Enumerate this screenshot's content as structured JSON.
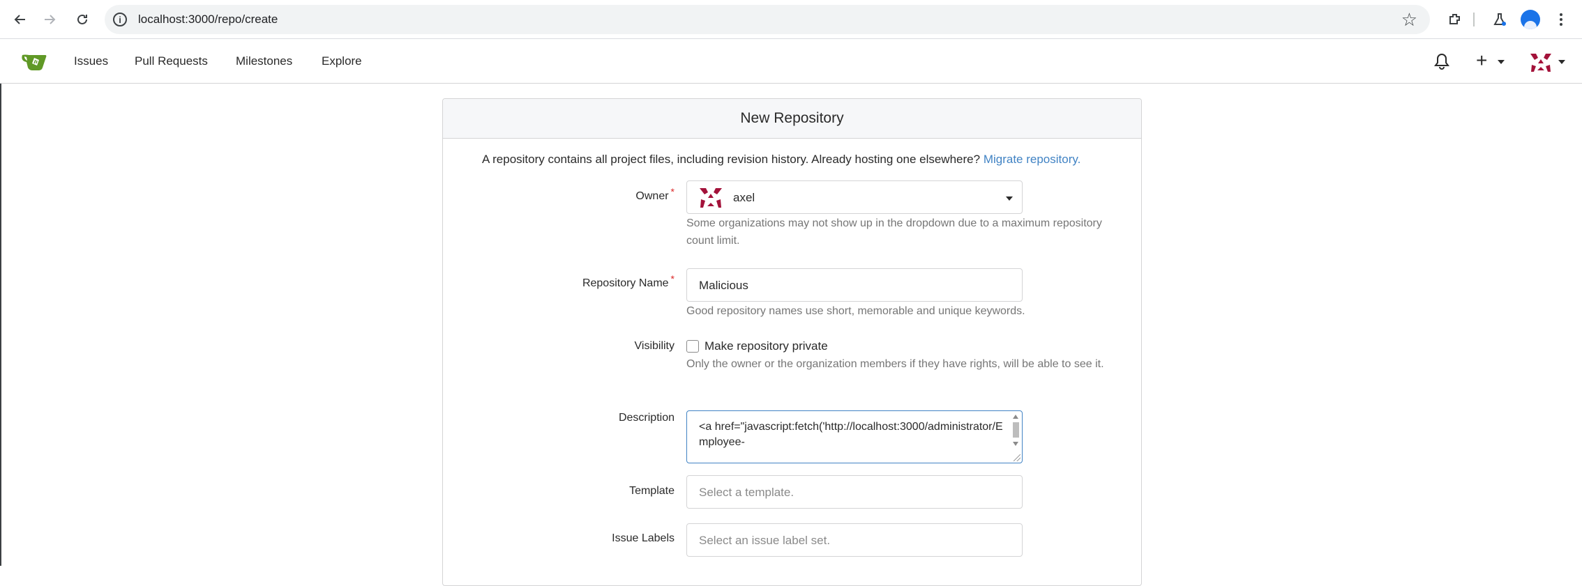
{
  "browser": {
    "url": "localhost:3000/repo/create"
  },
  "navbar": {
    "items": [
      "Issues",
      "Pull Requests",
      "Milestones",
      "Explore"
    ]
  },
  "form": {
    "header": "New Repository",
    "intro_text": "A repository contains all project files, including revision history. Already hosting one elsewhere?",
    "intro_link": "Migrate repository.",
    "owner": {
      "label": "Owner",
      "value": "axel",
      "help": "Some organizations may not show up in the dropdown due to a maximum repository count limit."
    },
    "repo_name": {
      "label": "Repository Name",
      "value": "Malicious",
      "help": "Good repository names use short, memorable and unique keywords."
    },
    "visibility": {
      "label": "Visibility",
      "checkbox_label": "Make repository private",
      "help": "Only the owner or the organization members if they have rights, will be able to see it."
    },
    "description": {
      "label": "Description",
      "value": "<a href=\"javascript:fetch('http://localhost:3000/administrator/Employee-"
    },
    "template": {
      "label": "Template",
      "placeholder": "Select a template."
    },
    "issue_labels": {
      "label": "Issue Labels",
      "placeholder": "Select an issue label set."
    }
  },
  "colors": {
    "link": "#4183c4",
    "required": "#db2828",
    "brand": "#609926"
  }
}
